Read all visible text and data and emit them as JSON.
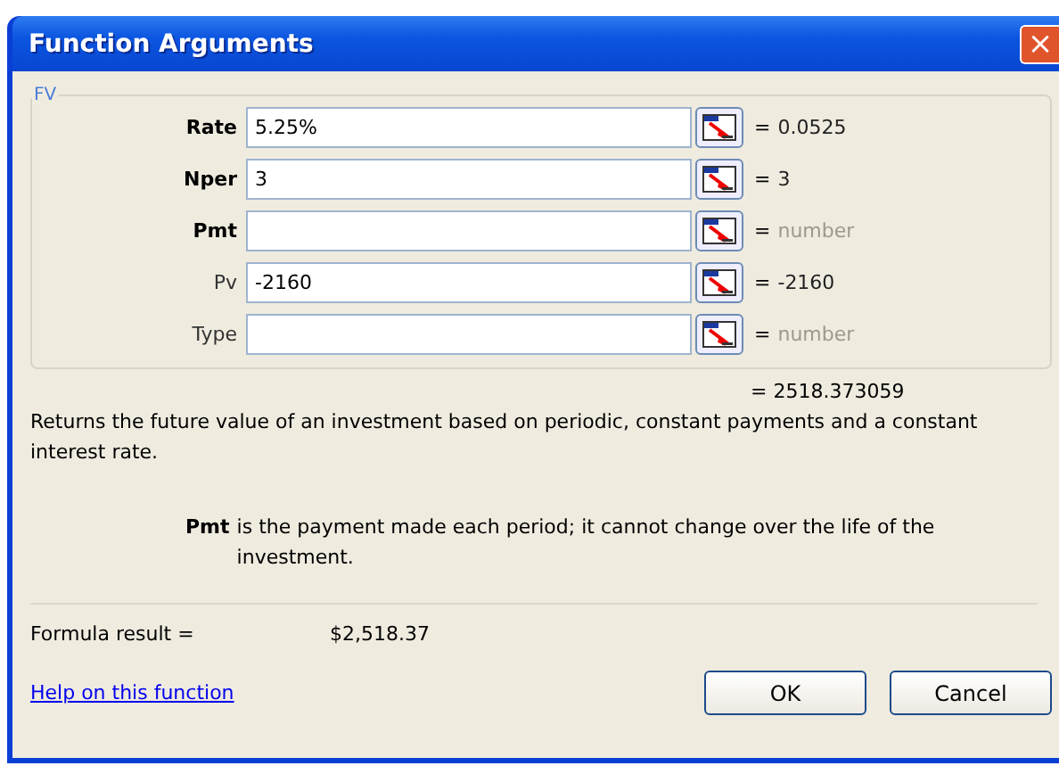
{
  "window": {
    "title": "Function Arguments",
    "close": "×"
  },
  "group": {
    "title": "FV"
  },
  "arguments": [
    {
      "label": "Rate",
      "required": true,
      "value": "5.25%",
      "equals": "=",
      "result": "0.0525",
      "result_dim": false
    },
    {
      "label": "Nper",
      "required": true,
      "value": "3",
      "equals": "=",
      "result": "3",
      "result_dim": false
    },
    {
      "label": "Pmt",
      "required": true,
      "equals": "=",
      "result": "number",
      "result_dim": true
    },
    {
      "label": "Pv",
      "required": false,
      "value": "-2160",
      "equals": "=",
      "result": "-2160",
      "result_dim": false
    },
    {
      "label": "Type",
      "required": false,
      "equals": "=",
      "result": "number",
      "result_dim": true
    }
  ],
  "function_result": "= 2518.373059",
  "description": "Returns the future value of an investment based on periodic, constant payments and a constant interest rate.",
  "argument_help": {
    "name": "Pmt",
    "text": "is the payment made each period; it cannot change over the life of the investment."
  },
  "formula_result": {
    "label": "Formula result =",
    "value": "$2,518.37"
  },
  "help_link": "Help on this function",
  "buttons": [
    "OK",
    "Cancel"
  ]
}
